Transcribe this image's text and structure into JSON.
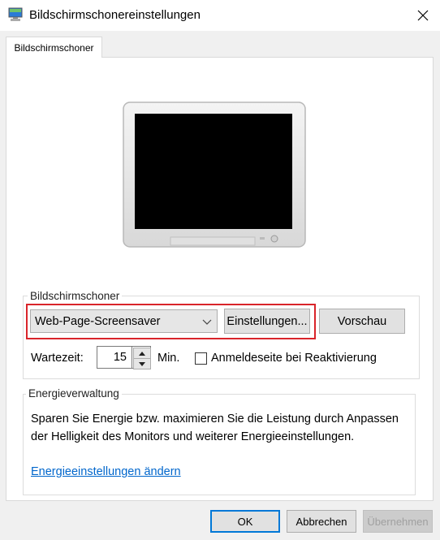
{
  "window": {
    "title": "Bildschirmschonereinstellungen",
    "icon": "screen-saver-icon",
    "close_icon": "close-icon"
  },
  "tabs": [
    {
      "label": "Bildschirmschoner",
      "selected": true
    }
  ],
  "preview": {
    "icon": "monitor-preview"
  },
  "screensaver_group": {
    "label": "Bildschirmschoner",
    "selected_screensaver": "Web-Page-Screensaver",
    "settings_button": "Einstellungen...",
    "preview_button": "Vorschau",
    "wait_label": "Wartezeit:",
    "wait_value": "15",
    "wait_unit": "Min.",
    "resume_checkbox_label": "Anmeldeseite bei Reaktivierung",
    "resume_checked": false
  },
  "energy_group": {
    "label": "Energieverwaltung",
    "description": "Sparen Sie Energie bzw. maximieren Sie die Leistung durch Anpassen der Helligkeit des Monitors und weiterer Energieeinstellungen.",
    "link": "Energieeinstellungen ändern"
  },
  "buttons": {
    "ok": "OK",
    "cancel": "Abbrechen",
    "apply": "Übernehmen"
  },
  "colors": {
    "highlight": "#d9242a",
    "link": "#0066cc",
    "focus": "#0078d7"
  }
}
